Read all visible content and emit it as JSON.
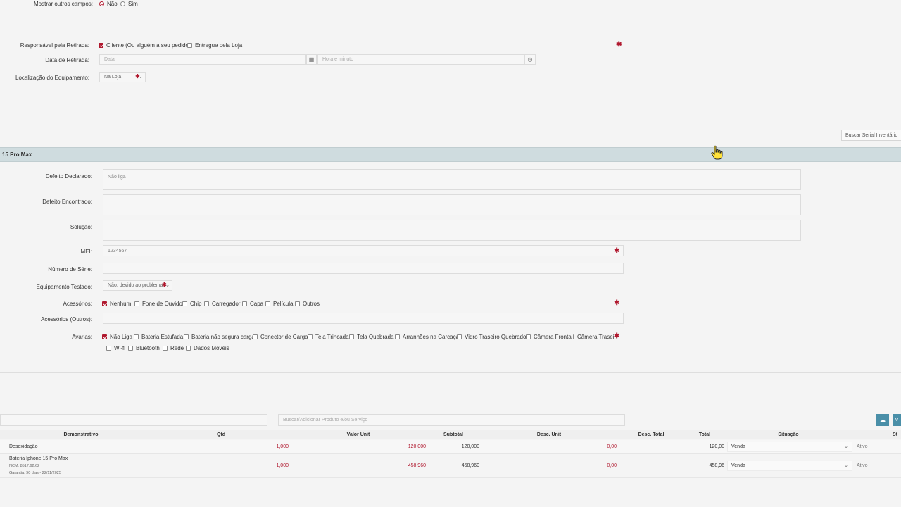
{
  "top": {
    "mostrar_label": "Mostrar outros campos:",
    "mostrar_nao": "Não",
    "mostrar_sim": "Sim"
  },
  "retirada": {
    "responsavel_label": "Responsável pela Retirada:",
    "opt_cliente": "Cliente (Ou alguém a seu pedido)",
    "opt_loja": "Entregue pela Loja",
    "data_label": "Data de Retirada:",
    "data_placeholder": "Data",
    "hora_placeholder": "Hora e minuto",
    "local_label": "Localização do Equipamento:",
    "local_value": "Na Loja"
  },
  "buscar_serial": "Buscar Serial Inventário",
  "device": {
    "title": "15 Pro Max",
    "defeito_declarado_label": "Defeito Declarado:",
    "defeito_declarado_value": "Não liga",
    "defeito_encontrado_label": "Defeito Encontrado:",
    "solucao_label": "Solução:",
    "imei_label": "IMEI:",
    "imei_value": "1234567",
    "serie_label": "Número de Série:",
    "testado_label": "Equipamento Testado:",
    "testado_value": "Não, devido ao problema",
    "acessorios_label": "Acessórios:",
    "acessorios": [
      "Nenhum",
      "Fone de Ouvido",
      "Chip",
      "Carregador",
      "Capa",
      "Película",
      "Outros"
    ],
    "acessorios_outros_label": "Acessórios (Outros):",
    "avarias_label": "Avarias:",
    "avarias_row1": [
      "Não Liga",
      "Bateria Estufada",
      "Bateria não segura carga",
      "Conector de Carga",
      "Tela Trincada",
      "Tela Quebrada",
      "Arranhões na Carcaça",
      "Vidro Traseiro Quebrado",
      "Câmera Frontal",
      "Câmera Traseira"
    ],
    "avarias_row2": [
      "Wi-fi",
      "Bluetooth",
      "Rede",
      "Dados Móveis"
    ]
  },
  "products": {
    "search_placeholder": "Buscar/Adicionar Produto e/ou Serviço",
    "headers": [
      "Demonstrativo",
      "Qtd",
      "Valor Unit",
      "Subtotal",
      "Desc. Unit",
      "Desc. Total",
      "Total",
      "Situação",
      "St"
    ],
    "rows": [
      {
        "name": "Desoxidação",
        "ncm": "",
        "garantia": "",
        "qtd": "1,000",
        "valor": "120,000",
        "subtotal": "120,000",
        "desc": "0,00",
        "total": "120,00",
        "situacao": "Venda",
        "status": "Ativo"
      },
      {
        "name": "Bateria Iphone 15 Pro Max",
        "ncm": "NCM: 8517.62.62",
        "garantia": "Garantia: 90 dias - 22/11/2025",
        "qtd": "1,000",
        "valor": "458,960",
        "subtotal": "458,960",
        "desc": "0,00",
        "total": "458,96",
        "situacao": "Venda",
        "status": "Ativo"
      }
    ]
  },
  "colors": {
    "accent": "#b0182e",
    "band": "#cfdcdf",
    "button": "#4a8fa8"
  }
}
